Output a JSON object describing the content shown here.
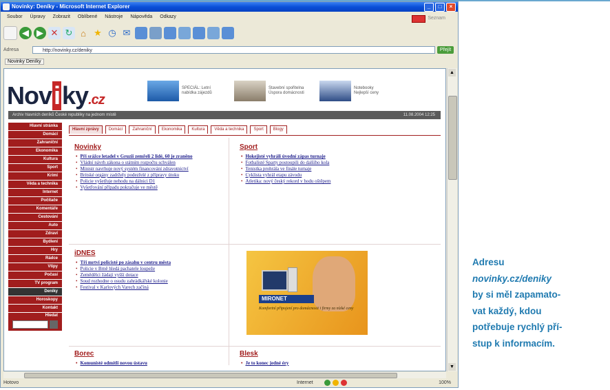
{
  "browser": {
    "window_title": "Novinky: Deníky - Microsoft Internet Explorer",
    "menu": [
      "Soubor",
      "Úpravy",
      "Zobrazit",
      "Oblíbené",
      "Nástroje",
      "Nápověda",
      "Odkazy"
    ],
    "brand_text": "Seznam",
    "address_label": "Adresa",
    "address_url": "http://novinky.cz/deniky",
    "go_label": "Přejít",
    "links": [
      "Novinky Deníky"
    ],
    "status_text": "Hotovo",
    "zone_text": "Internet",
    "zoom_text": "100%"
  },
  "site": {
    "logo_main": "Nov",
    "logo_box": "i",
    "logo_rest": "ky",
    "logo_tld": ".cz",
    "ads": [
      {
        "text": "SPECIÁL: Letní nabídka zájezdů"
      },
      {
        "text": "Stavební spořitelna Úspora domácnosti"
      },
      {
        "text": "Notebooky Nejlepší ceny"
      }
    ],
    "infobar_text": "Archiv hlavních deníků České republiky na jednom místě",
    "infobar_date": "11.08.2004 12:25",
    "left_menu": [
      "Hlavní stránka",
      "Domácí",
      "Zahraniční",
      "Ekonomika",
      "Kultura",
      "Sport",
      "Krimi",
      "Věda a technika",
      "Internet",
      "Počítače",
      "Komentáře",
      "Cestování",
      "Auto",
      "Zdraví",
      "Bydlení",
      "Hry",
      "Rádce",
      "Vtipy",
      "Počasí",
      "TV program",
      "Deníky",
      "Horoskopy",
      "Kontakt"
    ],
    "left_menu_dark_index": 20,
    "search_label": "Hledat",
    "tabs": [
      "Hlavní zprávy",
      "Domácí",
      "Zahraniční",
      "Ekonomika",
      "Kultura",
      "Věda a technika",
      "Sport",
      "Blogy"
    ],
    "novinky": {
      "title": "Novinky",
      "items": [
        "Při srážce letadel v Gruzii zemřeli 2 lidé, 60 je zraněno",
        "Vládní návrh zákona o státním rozpočtu schválen",
        "Ministr navrhuje nový systém financování zdravotnictví",
        "Britské orgány zadržely podezřelé z přípravy útoku",
        "Policie vyšetřuje nehodu na dálnici D1",
        "Vyšetřování případu pokračuje ve městě"
      ]
    },
    "sport": {
      "title": "Sport",
      "items": [
        "Hokejisté vyhráli úvodní zápas turnaje",
        "Fotbalisté Sparty postoupili do dalšího kola",
        "Tenistka prohrála ve finále turnaje",
        "Cyklista vyhrál etapu závodu",
        "Atletika: nový český rekord v hodu oštěpem"
      ]
    },
    "idnes": {
      "title": "iDNES",
      "items": [
        "Tři mrtví policisté po zásahu v centru města",
        "Policie v Brně hledá pachatele loupeže",
        "Zemědělci žádají vyšší dotace",
        "Soud rozhodne o osudu zahrádkářské kolonie",
        "Festival v Karlových Varech začíná"
      ]
    },
    "bottom_left": {
      "title": "Borec",
      "items": [
        "Komunisté odmítli novou ústavu"
      ]
    },
    "bottom_right": {
      "title": "Blesk",
      "items": [
        "Je to konec jedné éry"
      ]
    },
    "ad_mironet": {
      "brand": "MIRONET",
      "slogan": "Komfortní připojení pro domácnosti i firmy za nízké ceny"
    }
  },
  "caption": {
    "line1": "Adresu",
    "url": "novinky.cz/deniky",
    "line3": "by si měl zapamato-",
    "line4": "vat každý, kdou",
    "line5": "potřebuje rychlý pří-",
    "line6": "stup k informacím."
  },
  "colors": {
    "accent_red": "#a11d1d",
    "caption_blue": "#1f7ab0",
    "xp_blue": "#0a4fd8"
  }
}
